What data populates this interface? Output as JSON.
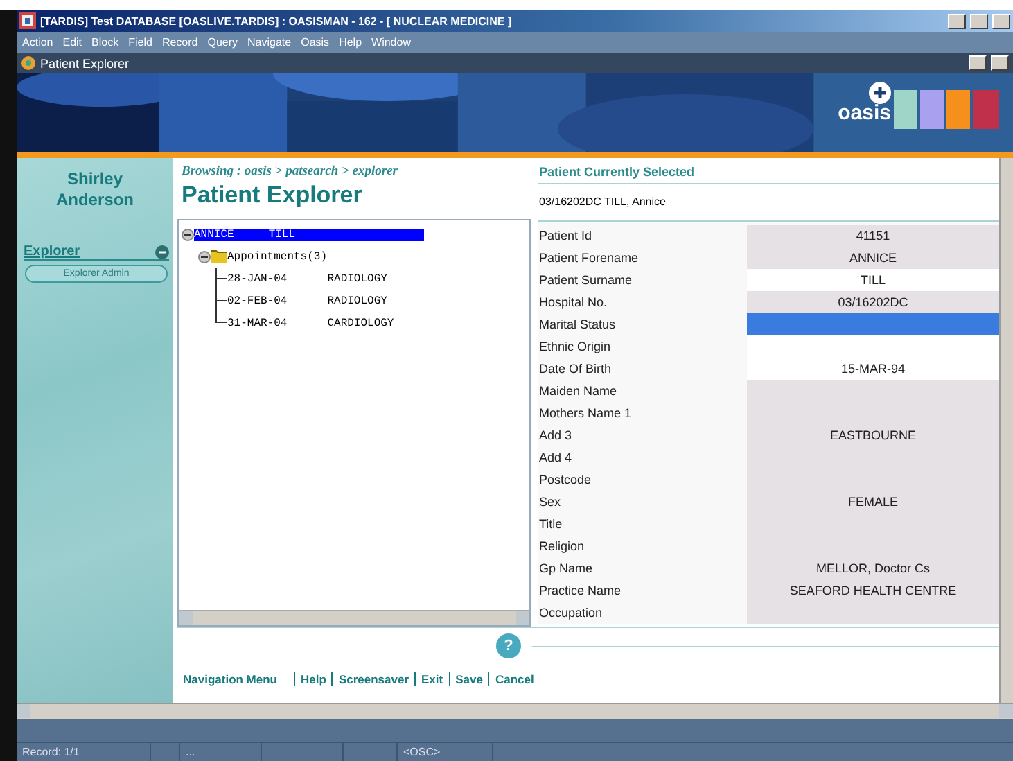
{
  "window": {
    "title": "[TARDIS] Test DATABASE [OASLIVE.TARDIS] : OASISMAN - 162 - [ NUCLEAR MEDICINE ]"
  },
  "menu": [
    "Action",
    "Edit",
    "Block",
    "Field",
    "Record",
    "Query",
    "Navigate",
    "Oasis",
    "Help",
    "Window"
  ],
  "inner_window": {
    "title": "Patient Explorer"
  },
  "banner": {
    "logo_text": "oasis"
  },
  "sidebar": {
    "user_first": "Shirley",
    "user_last": "Anderson",
    "section": "Explorer",
    "section_expanded": true,
    "items": [
      "Explorer Admin"
    ]
  },
  "breadcrumb": "Browsing : oasis > patsearch > explorer",
  "page_title": "Patient Explorer",
  "tree": {
    "cells": [
      "ANNICE",
      "TILL"
    ],
    "selected": true,
    "expanded": true,
    "children": [
      {
        "cells": [
          "Appointments(3)"
        ],
        "selected": false,
        "expanded": true,
        "children": [
          {
            "cells": [
              "28-JAN-04",
              "RADIOLOGY"
            ],
            "selected": false
          },
          {
            "cells": [
              "02-FEB-04",
              "RADIOLOGY"
            ],
            "selected": false
          },
          {
            "cells": [
              "31-MAR-04",
              "CARDIOLOGY"
            ],
            "selected": false
          }
        ]
      }
    ]
  },
  "selected_patient": {
    "heading": "Patient Currently Selected",
    "summary": "03/16202DC TILL, Annice"
  },
  "fields": [
    {
      "label": "Patient Id",
      "value": "41151",
      "shaded": true,
      "selected": false
    },
    {
      "label": "Patient Forename",
      "value": "ANNICE",
      "shaded": true,
      "selected": false
    },
    {
      "label": "Patient Surname",
      "value": "TILL",
      "shaded": false,
      "selected": false
    },
    {
      "label": "Hospital No.",
      "value": "03/16202DC",
      "shaded": true,
      "selected": false
    },
    {
      "label": "Marital Status",
      "shaded": false,
      "selected": true
    },
    {
      "label": "Ethnic Origin",
      "shaded": false,
      "selected": false
    },
    {
      "label": "Date Of Birth",
      "value": "15-MAR-94",
      "shaded": false,
      "selected": false
    },
    {
      "label": "Maiden Name",
      "shaded": true,
      "selected": false
    },
    {
      "label": "Mothers Name 1",
      "shaded": true,
      "selected": false
    },
    {
      "label": "Add 3",
      "value": "EASTBOURNE",
      "shaded": true,
      "selected": false
    },
    {
      "label": "Add 4",
      "shaded": true,
      "selected": false
    },
    {
      "label": "Postcode",
      "shaded": true,
      "selected": false
    },
    {
      "label": "Sex",
      "value": "FEMALE",
      "shaded": true,
      "selected": false
    },
    {
      "label": "Title",
      "shaded": true,
      "selected": false
    },
    {
      "label": "Religion",
      "shaded": true,
      "selected": false
    },
    {
      "label": "Gp Name",
      "value": "MELLOR, Doctor  Cs",
      "shaded": true,
      "selected": false
    },
    {
      "label": "Practice Name",
      "value": "SEAFORD HEALTH CENTRE",
      "shaded": true,
      "selected": false
    },
    {
      "label": "Occupation",
      "shaded": true,
      "selected": false
    }
  ],
  "help_button": "?",
  "footer_links": [
    "Navigation Menu",
    "Help",
    "Screensaver",
    "Exit",
    "Save",
    "Cancel"
  ],
  "status_bar": [
    "Record: 1/1",
    "...",
    "<OSC>"
  ]
}
